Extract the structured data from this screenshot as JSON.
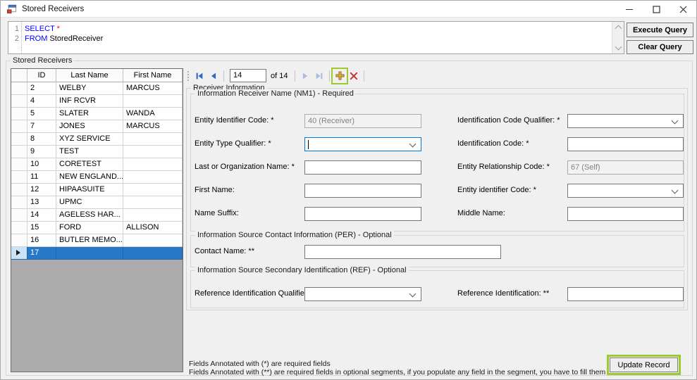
{
  "window": {
    "title": "Stored Receivers"
  },
  "colors": {
    "annotation_green": "#9dcb2f",
    "selection_blue": "#2878c8",
    "keyword_blue": "#0000ff",
    "asterisk_red": "#ff0000"
  },
  "query_editor": {
    "lines": [
      {
        "num": "1",
        "keyword": "SELECT",
        "rest": " *"
      },
      {
        "num": "2",
        "keyword": "FROM",
        "rest": " StoredReceiver"
      }
    ]
  },
  "buttons": {
    "execute": "Execute Query",
    "clear": "Clear Query",
    "update": "Update Record"
  },
  "stored_receivers_group": {
    "title": "Stored Receivers"
  },
  "grid": {
    "columns": {
      "id": "ID",
      "last": "Last Name",
      "first": "First Name"
    },
    "rows": [
      {
        "id": "2",
        "last": "WELBY",
        "first": "MARCUS"
      },
      {
        "id": "4",
        "last": "INF RCVR",
        "first": ""
      },
      {
        "id": "5",
        "last": "SLATER",
        "first": "WANDA"
      },
      {
        "id": "7",
        "last": "JONES",
        "first": "MARCUS"
      },
      {
        "id": "8",
        "last": "XYZ SERVICE",
        "first": ""
      },
      {
        "id": "9",
        "last": "TEST",
        "first": ""
      },
      {
        "id": "10",
        "last": "CORETEST",
        "first": ""
      },
      {
        "id": "11",
        "last": "NEW ENGLAND...",
        "first": ""
      },
      {
        "id": "12",
        "last": "HIPAASUITE",
        "first": ""
      },
      {
        "id": "13",
        "last": "UPMC",
        "first": ""
      },
      {
        "id": "14",
        "last": "AGELESS HAR...",
        "first": ""
      },
      {
        "id": "15",
        "last": "FORD",
        "first": "ALLISON"
      },
      {
        "id": "16",
        "last": "BUTLER MEMO...",
        "first": ""
      },
      {
        "id": "17",
        "last": "",
        "first": ""
      }
    ]
  },
  "navigator": {
    "position": "14",
    "of_label": "of 14"
  },
  "receiver_info": {
    "title": "Receiver Information",
    "nm1": {
      "title": "Information Receiver Name (NM1) - Required",
      "entity_identifier_code": {
        "label": "Entity Identifier Code: *",
        "value": "40 (Receiver)"
      },
      "identification_code_qualifier": {
        "label": "Identification Code Qualifier: *",
        "value": ""
      },
      "entity_type_qualifier": {
        "label": "Entity Type Qualifier: *",
        "value": ""
      },
      "identification_code": {
        "label": "Identification Code: *",
        "value": ""
      },
      "last_or_organization_name": {
        "label": "Last or Organization Name: *",
        "value": ""
      },
      "entity_relationship_code": {
        "label": "Entity Relationship Code: *",
        "value": "67 (Self)"
      },
      "first_name": {
        "label": "First Name:",
        "value": ""
      },
      "entity_identifier_code2": {
        "label": "Entity identifier Code: *",
        "value": ""
      },
      "name_suffix": {
        "label": "Name Suffix:",
        "value": ""
      },
      "middle_name": {
        "label": "Middle Name:",
        "value": ""
      }
    },
    "per": {
      "title": "Information Source Contact Information (PER) - Optional",
      "contact_name": {
        "label": "Contact Name: **",
        "value": ""
      }
    },
    "ref": {
      "title": "Information Source Secondary Identification (REF) - Optional",
      "reference_identification_qualifier": {
        "label": "Reference Identification Qualifier: **",
        "value": ""
      },
      "reference_identification": {
        "label": "Reference Identification: **",
        "value": ""
      }
    },
    "notes": {
      "line1": "Fields Annotated with (*) are required fields",
      "line2": "Fields Annotated with (**) are required fields in optional segments, if you populate any field in the segment, you have to fill them too."
    }
  }
}
